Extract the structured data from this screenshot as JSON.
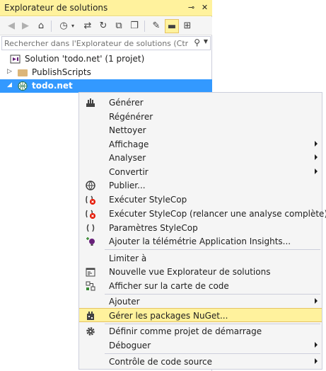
{
  "panel": {
    "title": "Explorateur de solutions",
    "pin_symbol": "⊸",
    "close_symbol": "✕"
  },
  "toolbar": {
    "buttons": [
      {
        "icon": "back-icon",
        "glyph": "◀"
      },
      {
        "icon": "forward-icon",
        "glyph": "▶"
      },
      {
        "icon": "home-icon",
        "glyph": "⌂"
      },
      {
        "icon": "history-icon",
        "glyph": "◷"
      },
      {
        "icon": "sync-icon",
        "glyph": "⇄"
      },
      {
        "icon": "refresh-icon",
        "glyph": "↻"
      },
      {
        "icon": "collapse-all-icon",
        "glyph": "⧉"
      },
      {
        "icon": "show-all-files-icon",
        "glyph": "❐"
      },
      {
        "icon": "properties-icon",
        "glyph": "✎"
      },
      {
        "icon": "preview-icon",
        "glyph": "▬"
      },
      {
        "icon": "code-map-icon",
        "glyph": "⊞"
      }
    ]
  },
  "search": {
    "placeholder": "Rechercher dans l'Explorateur de solutions (Ctrl+:)"
  },
  "tree": {
    "solution": "Solution 'todo.net' (1 projet)",
    "folder": "PublishScripts",
    "project": "todo.net"
  },
  "context_menu": {
    "items": [
      {
        "label": "Générer",
        "icon": "build-icon",
        "submenu": false
      },
      {
        "label": "Régénérer",
        "icon": "",
        "submenu": false
      },
      {
        "label": "Nettoyer",
        "icon": "",
        "submenu": false
      },
      {
        "label": "Affichage",
        "icon": "",
        "submenu": true
      },
      {
        "label": "Analyser",
        "icon": "",
        "submenu": true
      },
      {
        "label": "Convertir",
        "icon": "",
        "submenu": true
      },
      {
        "label": "Publier...",
        "icon": "publish-icon",
        "submenu": false
      },
      {
        "label": "Exécuter StyleCop",
        "icon": "stylecop-run-icon",
        "submenu": false
      },
      {
        "label": "Exécuter StyleCop (relancer une analyse complète)",
        "icon": "stylecop-rerun-icon",
        "submenu": false
      },
      {
        "label": "Paramètres StyleCop",
        "icon": "stylecop-settings-icon",
        "submenu": false
      },
      {
        "label": "Ajouter la télémétrie Application Insights...",
        "icon": "app-insights-icon",
        "submenu": false
      },
      {
        "label": "Limiter à",
        "icon": "",
        "submenu": false
      },
      {
        "label": "Nouvelle vue Explorateur de solutions",
        "icon": "new-view-icon",
        "submenu": false
      },
      {
        "label": "Afficher sur la carte de code",
        "icon": "code-map-icon",
        "submenu": false
      },
      {
        "label": "Ajouter",
        "icon": "",
        "submenu": true
      },
      {
        "label": "Gérer les packages NuGet...",
        "icon": "nuget-icon",
        "submenu": false,
        "highlighted": true
      },
      {
        "label": "Définir comme projet de démarrage",
        "icon": "gear-icon",
        "submenu": false
      },
      {
        "label": "Déboguer",
        "icon": "",
        "submenu": true
      },
      {
        "label": "Contrôle de code source",
        "icon": "",
        "submenu": true
      }
    ]
  },
  "colors": {
    "accent_yellow": "#fff29d",
    "selection_blue": "#3399ff",
    "menu_background": "#f5f5f5"
  }
}
